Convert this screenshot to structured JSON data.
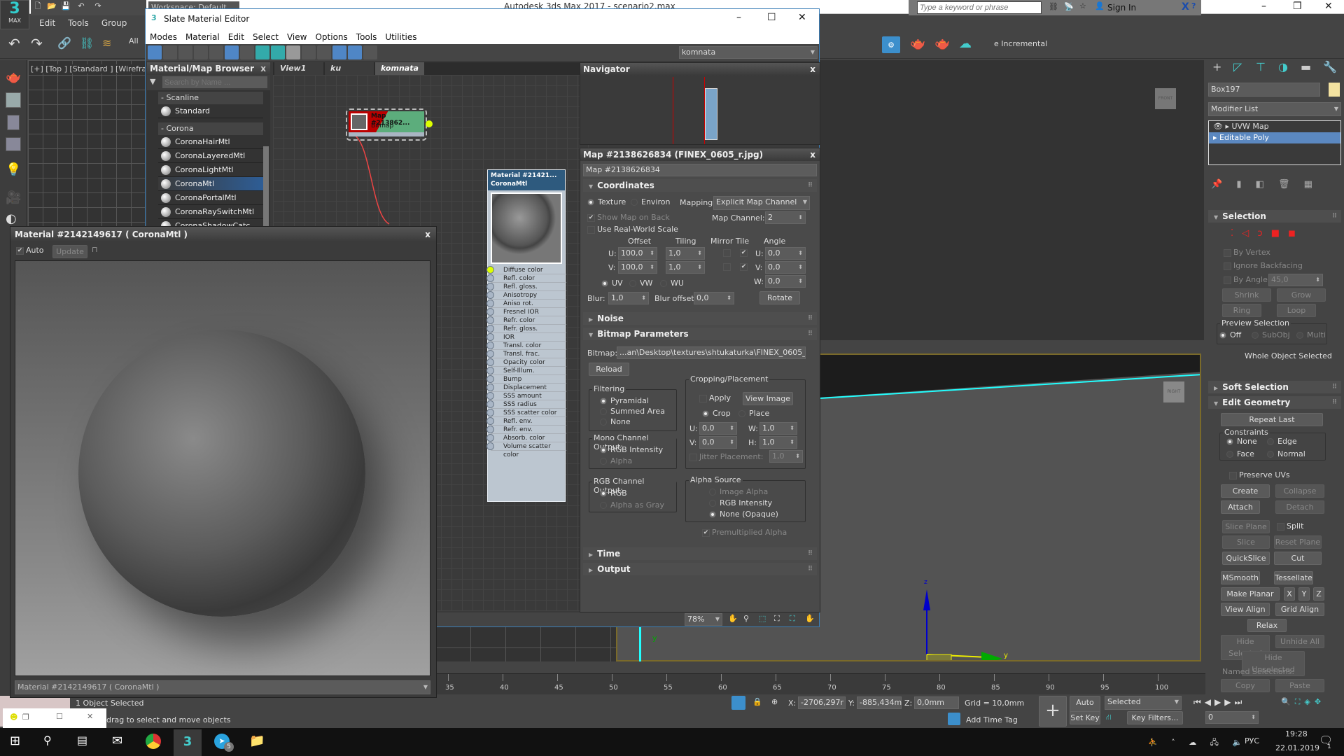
{
  "app": {
    "title": "Autodesk 3ds Max 2017 - scenario2.max",
    "logo_label": "MAX",
    "workspace": "Workspace: Default",
    "menu": [
      "Edit",
      "Tools",
      "Group"
    ],
    "search_placeholder": "Type a keyword or phrase",
    "sign_in": "Sign In",
    "selection_filter": "All",
    "toolbar_overflow": "e Incremental"
  },
  "viewport_top": {
    "label": "[+] [Top ] [Standard ] [Wireframe"
  },
  "viewcube": {
    "front": "FRONT",
    "right": "RIGHT"
  },
  "axis": {
    "x": "x",
    "y": "y",
    "z": "z"
  },
  "slate": {
    "title": "Slate Material Editor",
    "menu": [
      "Modes",
      "Material",
      "Edit",
      "Select",
      "View",
      "Options",
      "Tools",
      "Utilities"
    ],
    "view_dropdown": "komnata",
    "browser": {
      "title": "Material/Map Browser",
      "close": "x",
      "search_placeholder": "Search by Name ...",
      "groups": [
        {
          "name": "- Scanline",
          "items": [
            "Standard"
          ]
        },
        {
          "name": "- Corona",
          "items": [
            "CoronaHairMtl",
            "CoronaLayeredMtl",
            "CoronaLightMtl",
            "CoronaMtl",
            "CoronaPortalMtl",
            "CoronaRaySwitchMtl",
            "CoronaShadowCatc"
          ]
        }
      ],
      "selected": "CoronaMtl"
    },
    "tabs": [
      "View1",
      "ku",
      "komnata"
    ],
    "active_tab": "komnata",
    "map_node": {
      "title": "Map #213862...",
      "type": "Bitmap"
    },
    "mtl_node": {
      "title": "Material #21421...",
      "type": "CoronaMtl",
      "slots": [
        "Diffuse color",
        "Refl. color",
        "Refl. gloss.",
        "Anisotropy",
        "Aniso rot.",
        "Fresnel IOR",
        "Refr. color",
        "Refr. gloss.",
        "IOR",
        "Transl. color",
        "Transl. frac.",
        "Opacity color",
        "Self-Illum.",
        "Bump",
        "Displacement",
        "SSS amount",
        "SSS radius",
        "SSS scatter color",
        "Refl. env.",
        "Refr. env.",
        "Absorb. color",
        "Volume scatter color"
      ]
    },
    "navigator": {
      "title": "Navigator",
      "close": "x"
    },
    "zoom": "78%",
    "params": {
      "title": "Map #2138626834 (FINEX_0605_r.jpg)",
      "close": "x",
      "name": "Map #2138626834",
      "coordinates": {
        "title": "Coordinates",
        "texture": "Texture",
        "environ": "Environ",
        "mapping_label": "Mapping:",
        "mapping": "Explicit Map Channel",
        "show_map_on_back": "Show Map on Back",
        "map_channel_label": "Map Channel:",
        "map_channel": "2",
        "real_world": "Use Real-World Scale",
        "offset": "Offset",
        "tiling": "Tiling",
        "mirror_tile": "Mirror Tile",
        "angle": "Angle",
        "u": "U:",
        "v": "V:",
        "w": "W:",
        "offset_u": "100,0",
        "offset_v": "100,0",
        "tiling_u": "1,0",
        "tiling_v": "1,0",
        "angle_u": "0,0",
        "angle_v": "0,0",
        "angle_w": "0,0",
        "uv": "UV",
        "vw": "VW",
        "wu": "WU",
        "blur_label": "Blur:",
        "blur": "1,0",
        "blur_offset_label": "Blur offset:",
        "blur_offset": "0,0",
        "rotate": "Rotate"
      },
      "noise": "Noise",
      "bitmap": {
        "title": "Bitmap Parameters",
        "bitmap_label": "Bitmap:",
        "path": "...an\\Desktop\\textures\\shtukaturka\\FINEX_0605_r.jpg",
        "reload": "Reload",
        "filtering": "Filtering",
        "filters": [
          "Pyramidal",
          "Summed Area",
          "None"
        ],
        "mono": "Mono Channel Output:",
        "mono_opts": [
          "RGB Intensity",
          "Alpha"
        ],
        "rgb": "RGB Channel Output:",
        "rgb_opts": [
          "RGB",
          "Alpha as Gray"
        ],
        "crop": "Cropping/Placement",
        "apply": "Apply",
        "view_image": "View Image",
        "crop_opt": "Crop",
        "place_opt": "Place",
        "u": "U:",
        "v": "V:",
        "w": "W:",
        "h": "H:",
        "cu": "0,0",
        "cv": "0,0",
        "cw": "1,0",
        "ch": "1,0",
        "jitter": "Jitter Placement:",
        "jitter_val": "1,0",
        "alpha_src": "Alpha Source",
        "alpha_opts": [
          "Image Alpha",
          "RGB Intensity",
          "None (Opaque)"
        ],
        "premult": "Premultiplied Alpha"
      },
      "time": "Time",
      "output": "Output"
    }
  },
  "preview": {
    "title": "Material #2142149617  ( CoronaMtl )",
    "auto": "Auto",
    "update": "Update",
    "dropdown": "Material #2142149617  ( CoronaMtl )",
    "close": "x"
  },
  "command_panel": {
    "object_name": "Box197",
    "object_color": "#f3e2a0",
    "modifier_list": "Modifier List",
    "stack": [
      "UVW Map",
      "Editable Poly"
    ],
    "selection": {
      "title": "Selection",
      "by_vertex": "By Vertex",
      "ignore_backfacing": "Ignore Backfacing",
      "by_angle": "By Angle:",
      "angle": "45,0",
      "shrink": "Shrink",
      "grow": "Grow",
      "ring": "Ring",
      "loop": "Loop",
      "preview": "Preview Selection",
      "off": "Off",
      "subobj": "SubObj",
      "multi": "Multi",
      "status": "Whole Object Selected"
    },
    "soft_selection": "Soft Selection",
    "edit_geometry": {
      "title": "Edit Geometry",
      "repeat_last": "Repeat Last",
      "constraints": "Constraints",
      "none": "None",
      "edge": "Edge",
      "face": "Face",
      "normal": "Normal",
      "preserve_uvs": "Preserve UVs",
      "create": "Create",
      "collapse": "Collapse",
      "attach": "Attach",
      "detach": "Detach",
      "slice_plane": "Slice Plane",
      "split": "Split",
      "slice": "Slice",
      "reset_plane": "Reset Plane",
      "quickslice": "QuickSlice",
      "cut": "Cut",
      "msmooth": "MSmooth",
      "tessellate": "Tessellate",
      "make_planar": "Make Planar",
      "x": "X",
      "y": "Y",
      "z": "Z",
      "view_align": "View Align",
      "grid_align": "Grid Align",
      "relax": "Relax",
      "hide_selected": "Hide Selected",
      "unhide_all": "Unhide All",
      "hide_unselected": "Hide Unselected",
      "named_selections": "Named Selections:",
      "copy": "Copy",
      "paste": "Paste"
    }
  },
  "timeline": {
    "ticks": [
      "35",
      "40",
      "45",
      "50",
      "55",
      "60",
      "65",
      "70",
      "75",
      "80",
      "85",
      "90",
      "95",
      "100"
    ]
  },
  "status": {
    "selected": "1 Object Selected",
    "prompt": "drag to select and move objects",
    "x_label": "X:",
    "x": "-2706,297r",
    "y_label": "Y:",
    "y": "-885,434m",
    "z_label": "Z:",
    "z": "0,0mm",
    "grid": "Grid = 10,0mm",
    "add_time_tag": "Add Time Tag",
    "auto_key": "Auto Key",
    "set_key": "Set Key",
    "key_mode": "Selected",
    "key_filters": "Key Filters...",
    "frame": "0"
  },
  "taskbar": {
    "lang": "РУС",
    "time": "19:28",
    "date": "22.01.2019",
    "telegram_badge": "5",
    "notif_badge": "1"
  }
}
